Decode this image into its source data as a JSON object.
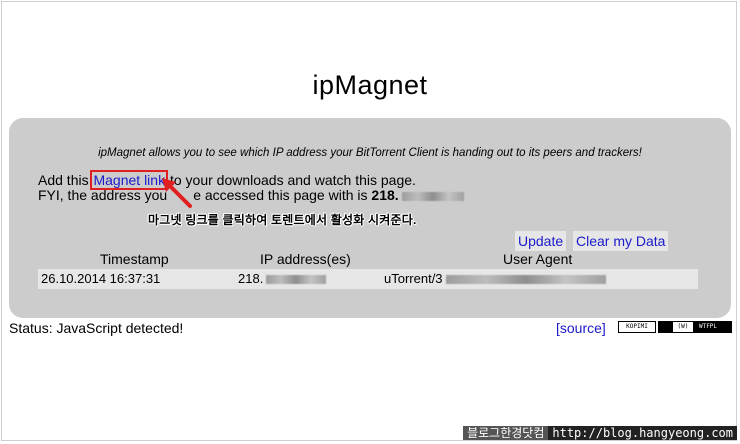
{
  "header": {
    "title": "ipMagnet"
  },
  "intro": {
    "text": "ipMagnet allows you to see which IP address your BitTorrent Client is handing out to its peers and trackers!"
  },
  "line1": {
    "prefix": "Add this ",
    "link": "Magnet link",
    "suffix": " to your downloads and watch this page."
  },
  "line2": {
    "prefix": "FYI, the address you",
    "suffix": "e accessed this page with is ",
    "ip": "218."
  },
  "annotation": {
    "text": "마그넷 링크를 클릭하여 토렌트에서 활성화 시켜준다.",
    "color": "#e02020"
  },
  "buttons": {
    "update": "Update",
    "clear": "Clear my Data"
  },
  "table": {
    "headers": [
      "Timestamp",
      "IP address(es)",
      "User Agent"
    ],
    "rows": [
      {
        "timestamp": "26.10.2014 16:37:31",
        "ip": "218.",
        "agent": "uTorrent/3"
      }
    ]
  },
  "footer": {
    "status": "Status: JavaScript detected!",
    "source": "[source]",
    "badge_kopimi": "KOPIMI",
    "badge_wtfpl": "WTFPL"
  },
  "watermark": {
    "name": "블로그한경닷컴",
    "url": "http://blog.hangyeong.com"
  },
  "colors": {
    "panel": "#cccccc",
    "link": "#1a1acc",
    "highlight": "#e02020"
  }
}
